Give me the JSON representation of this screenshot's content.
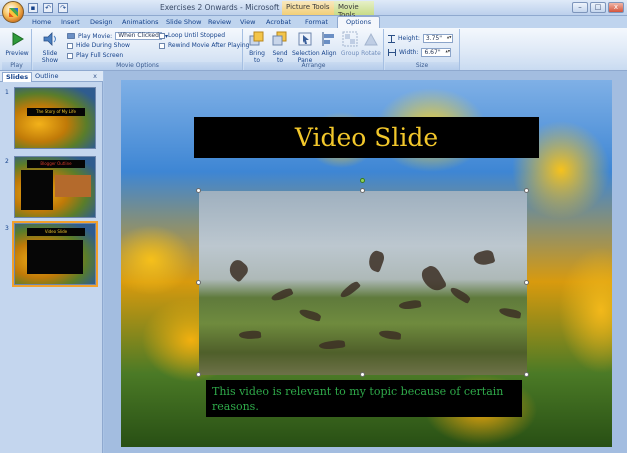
{
  "window": {
    "title": "Exercises 2 Onwards - Microsoft PowerPoint",
    "context_tools": [
      "Picture Tools",
      "Movie Tools"
    ],
    "controls": [
      "–",
      "□",
      "x"
    ]
  },
  "tabs": [
    {
      "label": "Home",
      "active": false
    },
    {
      "label": "Insert",
      "active": false
    },
    {
      "label": "Design",
      "active": false
    },
    {
      "label": "Animations",
      "active": false
    },
    {
      "label": "Slide Show",
      "active": false
    },
    {
      "label": "Review",
      "active": false
    },
    {
      "label": "View",
      "active": false
    },
    {
      "label": "Acrobat",
      "active": false
    },
    {
      "label": "Format",
      "active": false
    },
    {
      "label": "Options",
      "active": true
    }
  ],
  "ribbon": {
    "play_group": {
      "label": "Play",
      "preview": "Preview"
    },
    "movie_options": {
      "label": "Movie Options",
      "slide_show_volume": "Slide Show Volume",
      "play_movie_label": "Play Movie:",
      "play_movie_value": "When Clicked",
      "hide_during_show": "Hide During Show",
      "play_full_screen": "Play Full Screen",
      "loop_until_stopped": "Loop Until Stopped",
      "rewind_after_playing": "Rewind Movie After Playing"
    },
    "arrange": {
      "label": "Arrange",
      "bring_to_front": "Bring to Front",
      "send_to_back": "Send to Back",
      "selection_pane": "Selection Pane",
      "align": "Align",
      "group": "Group",
      "rotate": "Rotate"
    },
    "size": {
      "label": "Size",
      "height_label": "Height:",
      "height_value": "3.75\"",
      "width_label": "Width:",
      "width_value": "6.67\""
    }
  },
  "panel": {
    "tabs": [
      "Slides",
      "Outline"
    ],
    "close": "x",
    "thumbnails": [
      {
        "number": "1",
        "title": "The Story of My Life"
      },
      {
        "number": "2",
        "title": "Blogger Outline"
      },
      {
        "number": "3",
        "title": "Video Slide"
      }
    ]
  },
  "slide": {
    "title": "Video Slide",
    "caption": "This video is relevant to my topic because of certain reasons."
  },
  "colors": {
    "title_text": "#f2c72b",
    "caption_text": "#2faa4a",
    "selected_thumb": "#f2a12c"
  }
}
